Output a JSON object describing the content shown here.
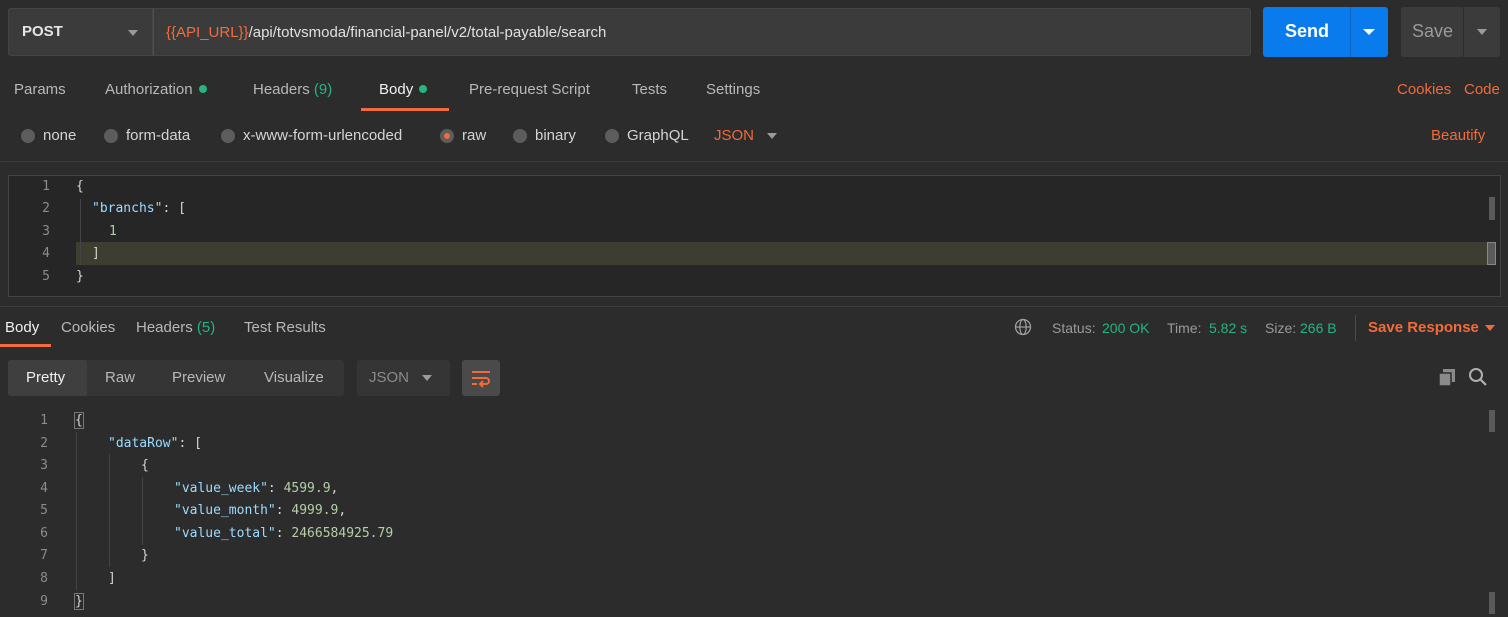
{
  "request": {
    "method": "POST",
    "url_var": "{{API_URL}}",
    "url_path": "/api/totvsmoda/financial-panel/v2/total-payable/search",
    "send_label": "Send",
    "save_label": "Save"
  },
  "request_tabs": {
    "params": "Params",
    "authorization": "Authorization",
    "headers": "Headers",
    "headers_count": "(9)",
    "body": "Body",
    "prerequest": "Pre-request Script",
    "tests": "Tests",
    "settings": "Settings",
    "cookies": "Cookies",
    "code": "Code"
  },
  "body_types": {
    "none": "none",
    "form_data": "form-data",
    "urlencoded": "x-www-form-urlencoded",
    "raw": "raw",
    "binary": "binary",
    "graphql": "GraphQL",
    "format": "JSON",
    "beautify": "Beautify",
    "selected": "raw"
  },
  "request_body": {
    "lines": [
      "1",
      "2",
      "3",
      "4",
      "5"
    ],
    "l1": "{",
    "l2_key": "\"branchs\"",
    "l2_rest": ": [",
    "l3": "1",
    "l4": "]",
    "l5": "}"
  },
  "response_tabs": {
    "body": "Body",
    "cookies": "Cookies",
    "headers": "Headers",
    "headers_count": "(5)",
    "test_results": "Test Results"
  },
  "response_meta": {
    "status_label": "Status:",
    "status_value": "200 OK",
    "time_label": "Time:",
    "time_value": "5.82 s",
    "size_label": "Size:",
    "size_value": "266 B",
    "save_response": "Save Response"
  },
  "view_modes": {
    "pretty": "Pretty",
    "raw": "Raw",
    "preview": "Preview",
    "visualize": "Visualize",
    "format": "JSON"
  },
  "response_body": {
    "lines": [
      "1",
      "2",
      "3",
      "4",
      "5",
      "6",
      "7",
      "8",
      "9"
    ],
    "l1": "{",
    "l2_key": "\"dataRow\"",
    "l2_rest": ": [",
    "l3": "{",
    "l4_key": "\"value_week\"",
    "l4_val": "4599.9",
    "l5_key": "\"value_month\"",
    "l5_val": "4999.9",
    "l6_key": "\"value_total\"",
    "l6_val": "2466584925.79",
    "l7": "}",
    "l8": "]",
    "l9": "}"
  },
  "colors": {
    "accent": "#f26b3a",
    "send": "#097bed",
    "success": "#26b47f",
    "background": "#2c2c2c"
  },
  "icons": [
    "chevron-down-icon",
    "globe-icon",
    "wrap-lines-icon",
    "copy-icon",
    "search-icon"
  ]
}
